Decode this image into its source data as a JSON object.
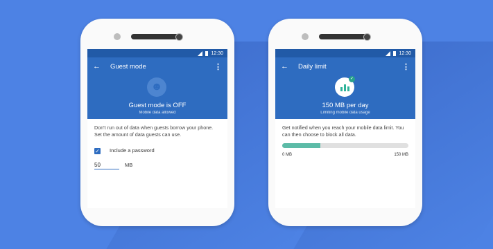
{
  "left_phone": {
    "status_time": "12:30",
    "appbar": {
      "back_icon": "arrow-back-icon",
      "title": "Guest mode",
      "more_icon": "more-vert-icon"
    },
    "hero": {
      "icon": "guest-face-icon",
      "title": "Guest mode is OFF",
      "subtitle": "Mobile data allowed"
    },
    "description": "Don't run out of data when guests borrow your phone. Set the amount of data guests can use.",
    "checkbox": {
      "label": "Include a password",
      "checked": true
    },
    "limit_field": {
      "value": "50",
      "unit": "MB"
    }
  },
  "right_phone": {
    "status_time": "12:30",
    "appbar": {
      "back_icon": "arrow-back-icon",
      "title": "Daily limit",
      "more_icon": "more-vert-icon"
    },
    "hero": {
      "icon": "data-usage-chart-icon",
      "title": "150 MB per day",
      "subtitle": "Limiting mobile data usage"
    },
    "description": "Get notified when you reach your mobile data limit. You can then choose to block all data.",
    "progress": {
      "fraction": 0.3,
      "min_label": "0 MB",
      "max_label": "150 MB"
    }
  },
  "colors": {
    "background": "#4d82e4",
    "app_bar": "#2e6cc0",
    "status_bar": "#215aa7",
    "accent": "#5cbba7"
  }
}
